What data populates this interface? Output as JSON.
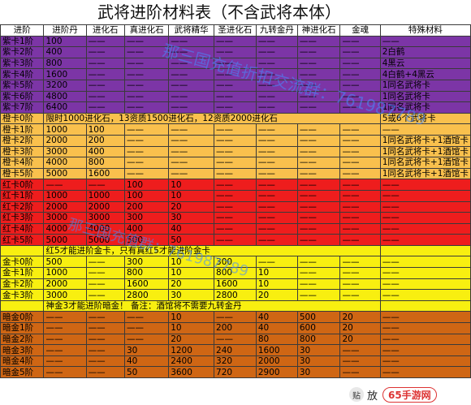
{
  "title": "武将进阶材料表（不含武将本体）",
  "headers": [
    "进阶",
    "进阶丹",
    "进化石",
    "真进化石",
    "武将精华",
    "圣进化石",
    "九转金丹",
    "神进化石",
    "金魂",
    "特殊材料"
  ],
  "rows": [
    {
      "band": "purple",
      "cells": [
        "紫卡1阶",
        "100",
        "——",
        "——",
        "——",
        "——",
        "——",
        "——",
        "——",
        "——"
      ]
    },
    {
      "band": "purple",
      "cells": [
        "紫卡2阶",
        "400",
        "——",
        "——",
        "——",
        "——",
        "——",
        "——",
        "——",
        "2白鹤"
      ]
    },
    {
      "band": "purple",
      "cells": [
        "紫卡3阶",
        "800",
        "——",
        "——",
        "——",
        "——",
        "——",
        "——",
        "——",
        "4黑云"
      ]
    },
    {
      "band": "purple",
      "cells": [
        "紫卡4阶",
        "1600",
        "——",
        "——",
        "——",
        "——",
        "——",
        "——",
        "——",
        "4白鹤+4黑云"
      ]
    },
    {
      "band": "purple",
      "cells": [
        "紫卡5阶",
        "3200",
        "——",
        "——",
        "——",
        "——",
        "——",
        "——",
        "——",
        "1同名武将卡"
      ]
    },
    {
      "band": "purple",
      "cells": [
        "紫卡6阶",
        "4800",
        "——",
        "——",
        "——",
        "——",
        "——",
        "——",
        "——",
        "1同名武将卡"
      ]
    },
    {
      "band": "purple",
      "cells": [
        "紫卡7阶",
        "6400",
        "——",
        "——",
        "——",
        "——",
        "——",
        "——",
        "——",
        "1同名武将卡"
      ]
    },
    {
      "band": "gold",
      "wide": true,
      "cells": [
        "橙卡0阶",
        "限时1000进化石，13资质1500进化石，12资质2000进化石",
        "5或6个武将卡"
      ]
    },
    {
      "band": "gold",
      "cells": [
        "橙卡1阶",
        "1000",
        "100",
        "——",
        "——",
        "——",
        "——",
        "——",
        "——",
        "——"
      ]
    },
    {
      "band": "gold",
      "cells": [
        "橙卡2阶",
        "2000",
        "200",
        "——",
        "——",
        "——",
        "——",
        "——",
        "——",
        "1同名武将卡+1酒馆卡"
      ]
    },
    {
      "band": "gold",
      "cells": [
        "橙卡3阶",
        "3000",
        "400",
        "——",
        "——",
        "——",
        "——",
        "——",
        "——",
        "1同名武将卡+1酒馆卡"
      ]
    },
    {
      "band": "gold",
      "cells": [
        "橙卡4阶",
        "4000",
        "800",
        "——",
        "——",
        "——",
        "——",
        "——",
        "——",
        "1同名武将卡+1酒馆卡"
      ]
    },
    {
      "band": "gold",
      "cells": [
        "橙卡5阶",
        "5000",
        "1600",
        "——",
        "——",
        "——",
        "——",
        "——",
        "——",
        "1同名武将卡+1酒馆卡"
      ]
    },
    {
      "band": "red",
      "cells": [
        "红卡0阶",
        "——",
        "——",
        "100",
        "10",
        "——",
        "——",
        "——",
        "——",
        "——"
      ]
    },
    {
      "band": "red",
      "cells": [
        "红卡1阶",
        "1000",
        "1000",
        "100",
        "10",
        "——",
        "——",
        "——",
        "——",
        "——"
      ]
    },
    {
      "band": "red",
      "cells": [
        "红卡2阶",
        "2000",
        "2000",
        "200",
        "20",
        "——",
        "——",
        "——",
        "——",
        "——"
      ]
    },
    {
      "band": "red",
      "cells": [
        "红卡3阶",
        "3000",
        "3000",
        "300",
        "30",
        "——",
        "——",
        "——",
        "——",
        "——"
      ]
    },
    {
      "band": "red",
      "cells": [
        "红卡4阶",
        "4000",
        "4000",
        "400",
        "40",
        "——",
        "——",
        "——",
        "——",
        "——"
      ]
    },
    {
      "band": "red",
      "cells": [
        "红卡5阶",
        "5000",
        "5000",
        "500",
        "50",
        "——",
        "——",
        "——",
        "——",
        "——"
      ]
    },
    {
      "band": "yellow",
      "wide": true,
      "cells": [
        "",
        "红5才能进阶金卡，只有真红5才能进阶金卡",
        ""
      ]
    },
    {
      "band": "yellow",
      "cells": [
        "金卡0阶",
        "500",
        "——",
        "300",
        "10",
        "300",
        "——",
        "——",
        "——",
        "——"
      ]
    },
    {
      "band": "yellow",
      "cells": [
        "金卡1阶",
        "1000",
        "——",
        "800",
        "10",
        "800",
        "10",
        "——",
        "——",
        "——"
      ]
    },
    {
      "band": "yellow",
      "cells": [
        "金卡2阶",
        "2000",
        "——",
        "1600",
        "20",
        "1600",
        "10",
        "——",
        "——",
        "——"
      ]
    },
    {
      "band": "yellow",
      "cells": [
        "金卡3阶",
        "3000",
        "——",
        "2800",
        "30",
        "2800",
        "20",
        "——",
        "——",
        "——"
      ]
    },
    {
      "band": "yellow",
      "wide": true,
      "cells": [
        "",
        "神金3才能进阶暗金！ 备注：酒馆将不需要九转金丹",
        ""
      ]
    },
    {
      "band": "brown",
      "cells": [
        "暗金0阶",
        "——",
        "——",
        "——",
        "10",
        "——",
        "40",
        "500",
        "20",
        "——"
      ]
    },
    {
      "band": "brown",
      "cells": [
        "暗金1阶",
        "——",
        "——",
        "——",
        "10",
        "200",
        "40",
        "600",
        "20",
        "——"
      ]
    },
    {
      "band": "brown",
      "cells": [
        "暗金2阶",
        "——",
        "——",
        "——",
        "20",
        "——",
        "80",
        "800",
        "20",
        "——"
      ]
    },
    {
      "band": "brown",
      "cells": [
        "暗金3阶",
        "——",
        "——",
        "30",
        "1200",
        "240",
        "1600",
        "30",
        "——",
        "——"
      ]
    },
    {
      "band": "brown",
      "cells": [
        "暗金4阶",
        "——",
        "——",
        "40",
        "2400",
        "320",
        "2000",
        "30",
        "——",
        "——"
      ]
    },
    {
      "band": "brown",
      "cells": [
        "暗金5阶",
        "——",
        "——",
        "50",
        "3600",
        "720",
        "2900",
        "30",
        "——",
        "——"
      ]
    }
  ],
  "watermarks": [
    "那三国充值折扣交流群：761987789",
    "那三国充值群：761987789"
  ],
  "logo": {
    "text": "放",
    "site": "65手游网"
  },
  "colors": {
    "purple": "#7c35a6",
    "gold": "#f9c04d",
    "red": "#ee1d1d",
    "yellow": "#f8ef10",
    "brown": "#cf6614"
  }
}
